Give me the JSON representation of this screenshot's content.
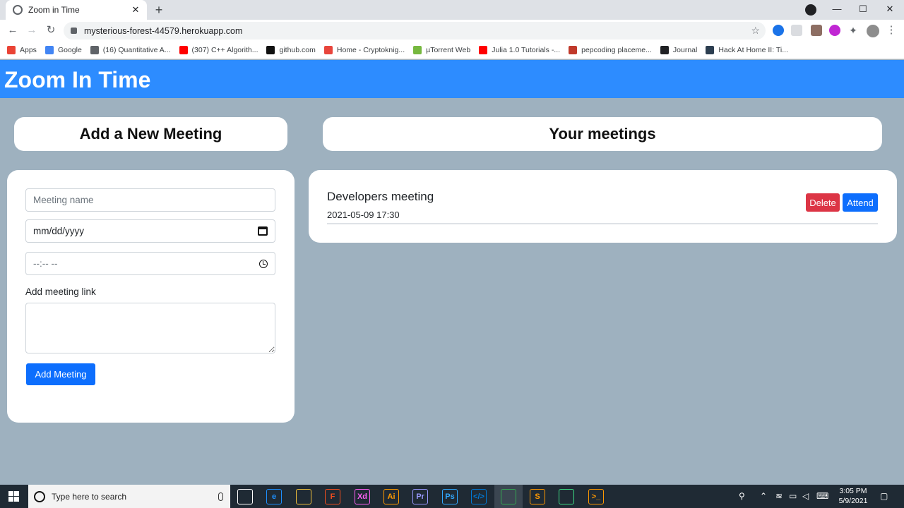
{
  "browser": {
    "tab_title": "Zoom in Time",
    "url": "mysterious-forest-44579.herokuapp.com",
    "bookmarks": [
      {
        "label": "Apps",
        "color": "#ea4335"
      },
      {
        "label": "Google",
        "color": "#4285f4"
      },
      {
        "label": "(16) Quantitative A...",
        "color": "#5f6368"
      },
      {
        "label": "(307) C++ Algorith...",
        "color": "#ff0000"
      },
      {
        "label": "github.com",
        "color": "#111111"
      },
      {
        "label": "Home - Cryptoknig...",
        "color": "#e8453c"
      },
      {
        "label": "µTorrent Web",
        "color": "#76b83f"
      },
      {
        "label": "Julia 1.0 Tutorials -...",
        "color": "#ff0000"
      },
      {
        "label": "pepcoding placeme...",
        "color": "#c0392b"
      },
      {
        "label": "Journal",
        "color": "#202124"
      },
      {
        "label": "Hack At Home II: Ti...",
        "color": "#2c3e50"
      }
    ]
  },
  "app": {
    "brand": "Zoom In Time",
    "add_section": {
      "title": "Add a New Meeting",
      "name_placeholder": "Meeting name",
      "date_value": "mm/dd/yyyy",
      "time_value": "--:-- --",
      "link_label": "Add meeting link",
      "submit_label": "Add Meeting"
    },
    "meetings_section": {
      "title": "Your meetings",
      "meetings": [
        {
          "name": "Developers meeting",
          "datetime": "2021-05-09 17:30",
          "delete_label": "Delete",
          "attend_label": "Attend"
        }
      ]
    }
  },
  "taskbar": {
    "search_placeholder": "Type here to search",
    "time": "3:05 PM",
    "date": "5/9/2021",
    "apps": [
      {
        "name": "task-view",
        "label": "",
        "color": "#ffffff"
      },
      {
        "name": "edge",
        "label": "e",
        "color": "#1e90ff"
      },
      {
        "name": "file-explorer",
        "label": "",
        "color": "#f0c03c"
      },
      {
        "name": "figma",
        "label": "F",
        "color": "#f24e1e"
      },
      {
        "name": "adobe-xd",
        "label": "Xd",
        "color": "#ff61f6"
      },
      {
        "name": "illustrator",
        "label": "Ai",
        "color": "#ff9a00"
      },
      {
        "name": "premiere",
        "label": "Pr",
        "color": "#9999ff"
      },
      {
        "name": "photoshop",
        "label": "Ps",
        "color": "#31a8ff"
      },
      {
        "name": "vscode",
        "label": "</>",
        "color": "#0078d4"
      },
      {
        "name": "chrome",
        "label": "",
        "color": "#34a853"
      },
      {
        "name": "sublime",
        "label": "S",
        "color": "#ff9800"
      },
      {
        "name": "android-studio",
        "label": "",
        "color": "#3ddc84"
      },
      {
        "name": "terminal",
        "label": ">_",
        "color": "#ff9900"
      }
    ]
  }
}
